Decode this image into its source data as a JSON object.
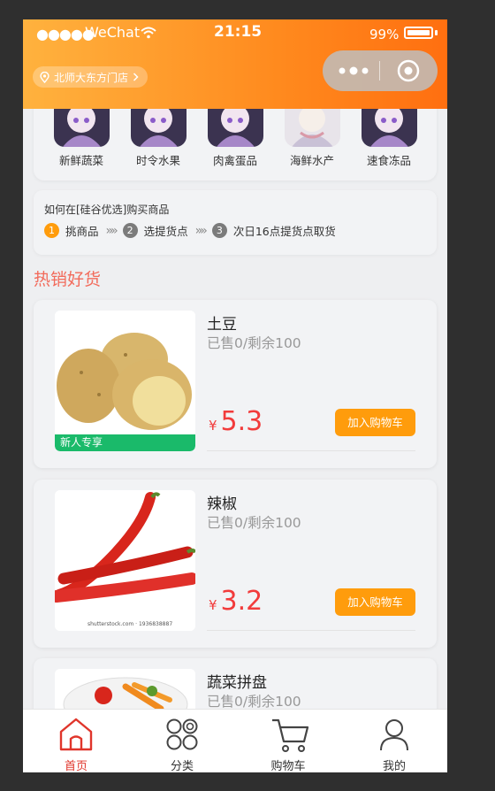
{
  "status_bar": {
    "signal": "●●●●●",
    "carrier": "WeChat",
    "time": "21:15",
    "battery": "99%"
  },
  "header": {
    "store_name": "北师大东方门店"
  },
  "categories": [
    {
      "label": "新鲜蔬菜"
    },
    {
      "label": "时令水果"
    },
    {
      "label": "肉禽蛋品"
    },
    {
      "label": "海鲜水产"
    },
    {
      "label": "速食冻品"
    }
  ],
  "howto": {
    "title": "如何在[硅谷优选]购买商品",
    "steps": [
      {
        "num": "1",
        "label": "挑商品",
        "color": "#ff9c0c"
      },
      {
        "num": "2",
        "label": "选提货点",
        "color": "#7b7b7b"
      },
      {
        "num": "3",
        "label": "次日16点提货点取货",
        "color": "#7b7b7b"
      }
    ],
    "separator": "»»"
  },
  "section_title": "热销好货",
  "products": [
    {
      "name": "土豆",
      "sold": "已售0/剩余100",
      "currency": "¥",
      "price": "5.3",
      "badge": "新人专享",
      "add_label": "加入购物车"
    },
    {
      "name": "辣椒",
      "sold": "已售0/剩余100",
      "currency": "¥",
      "price": "3.2",
      "add_label": "加入购物车",
      "watermark": "shutterstock.com · 1936838887"
    },
    {
      "name": "蔬菜拼盘",
      "sold": "已售0/剩余100"
    }
  ],
  "tabbar": [
    {
      "label": "首页",
      "icon": "home-icon",
      "active": true
    },
    {
      "label": "分类",
      "icon": "category-icon"
    },
    {
      "label": "购物车",
      "icon": "cart-icon"
    },
    {
      "label": "我的",
      "icon": "user-icon"
    }
  ],
  "colors": {
    "accent": "#ff8a1e",
    "price": "#f23b3b",
    "button": "#ff9c0c",
    "badge": "#1aba6a",
    "active_tab": "#e0352b"
  }
}
